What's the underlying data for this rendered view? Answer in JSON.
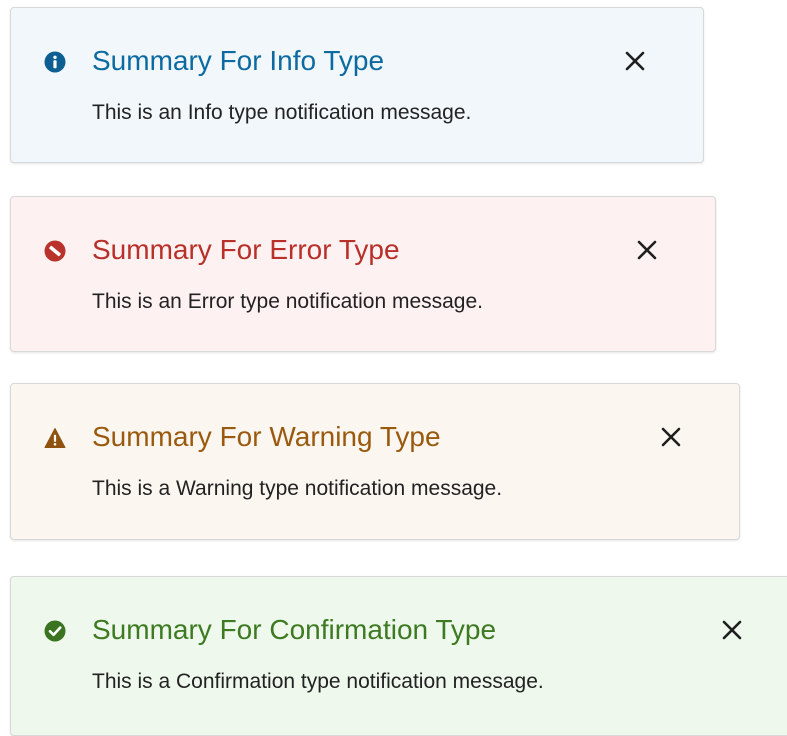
{
  "notifications": [
    {
      "type": "info",
      "summary": "Summary For Info Type",
      "message": "This is an Info type notification message.",
      "icon": "info-icon",
      "accent_color": "#0d6aa0",
      "background": "#f1f7fb"
    },
    {
      "type": "error",
      "summary": "Summary For Error Type",
      "message": "This is an Error type notification message.",
      "icon": "error-icon",
      "accent_color": "#b7302a",
      "background": "#fdf2f1"
    },
    {
      "type": "warning",
      "summary": "Summary For Warning Type",
      "message": "This is a Warning type notification message.",
      "icon": "warning-icon",
      "accent_color": "#9a5a0e",
      "background": "#fcf6f1"
    },
    {
      "type": "confirmation",
      "summary": "Summary For Confirmation Type",
      "message": "This is a Confirmation type notification message.",
      "icon": "check-circle-icon",
      "accent_color": "#3d7a22",
      "background": "#eef8ec"
    }
  ],
  "close_icon": "close-icon"
}
